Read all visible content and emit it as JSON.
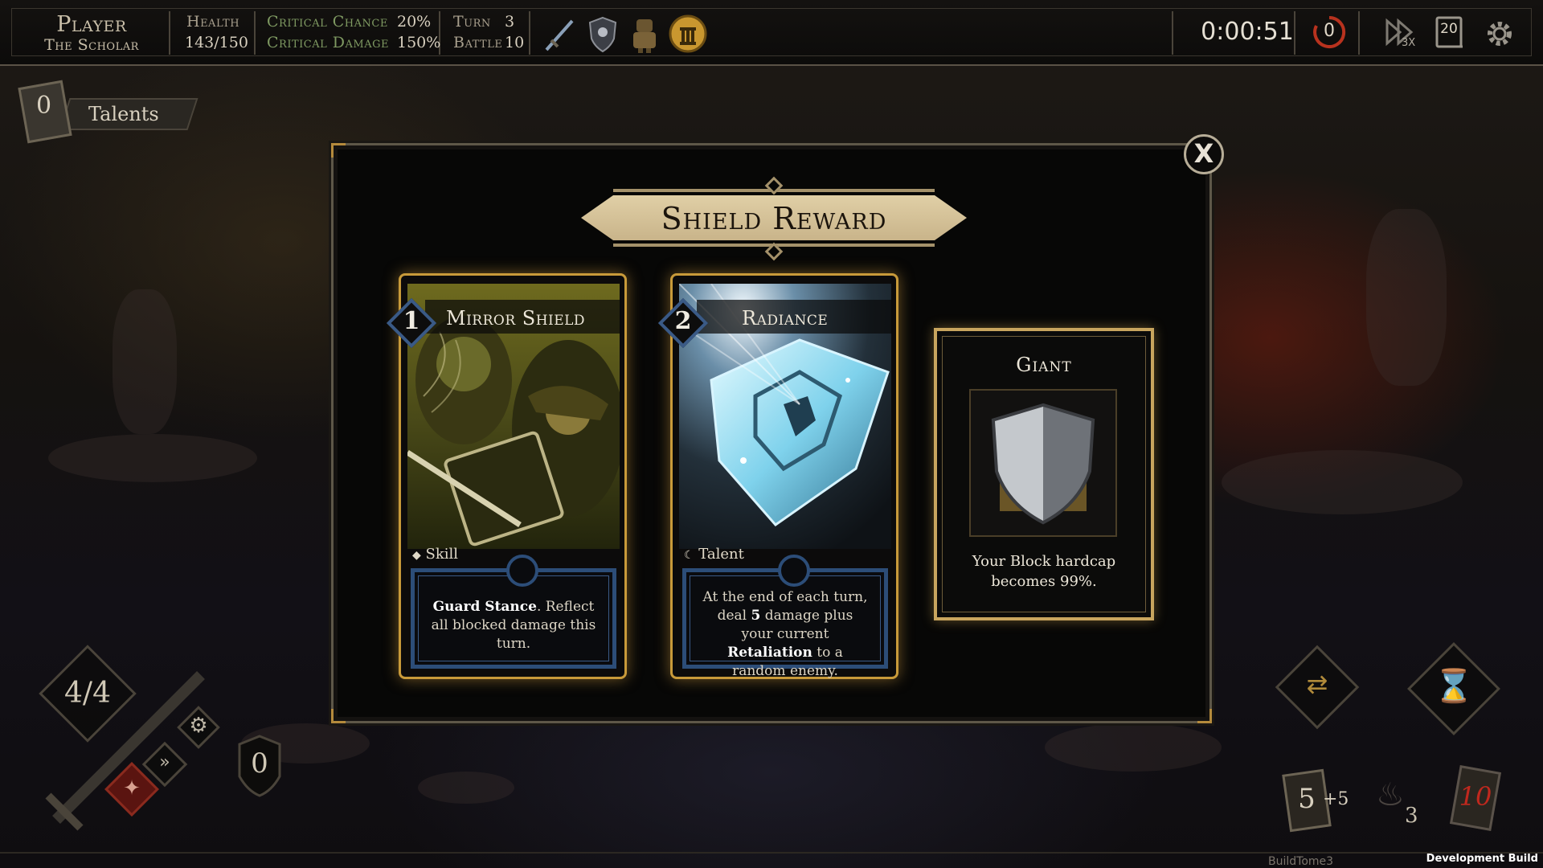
{
  "player": {
    "name_label": "Player",
    "class_label": "The Scholar",
    "health_label": "Health",
    "health_value": "143/150",
    "crit_chance_label": "Critical Chance",
    "crit_chance_value": "20%",
    "crit_damage_label": "Critical Damage",
    "crit_damage_value": "150%",
    "turn_label": "Turn",
    "turn_value": "3",
    "battle_label": "Battle",
    "battle_value": "10"
  },
  "top_icons": [
    "sword-relic-icon",
    "shield-relic-icon",
    "golem-relic-icon",
    "temple-coin-icon"
  ],
  "timer": "0:00:51",
  "reroll_count": "0",
  "speed_label": "3X",
  "deck_count_top": "20",
  "talents": {
    "count": "0",
    "label": "Talents"
  },
  "modal": {
    "title": "Shield Reward",
    "close_label": "X"
  },
  "cards": [
    {
      "cost": "1",
      "name": "Mirror Shield",
      "type_glyph": "◆",
      "type": "Skill",
      "desc_bold": "Guard Stance",
      "desc_rest": ". Reflect all blocked damage this turn."
    },
    {
      "cost": "2",
      "name": "Radiance",
      "type_glyph": "☾",
      "type": "Talent",
      "desc_pre": "At the end of each turn, deal",
      "desc_num": "5",
      "desc_mid": "damage plus your current",
      "desc_bold": "Retaliation",
      "desc_post": "to a random enemy."
    }
  ],
  "giant": {
    "title": "Giant",
    "text": "Your Block hardcap becomes 99%."
  },
  "hud": {
    "energy": "4/4",
    "block": "0",
    "draw_pile": "5",
    "draw_bonus": "+5",
    "exhaust_count": "3",
    "discard_count": "10"
  },
  "footer": {
    "build_name": "BuildTome3",
    "dev_build": "Development Build"
  }
}
